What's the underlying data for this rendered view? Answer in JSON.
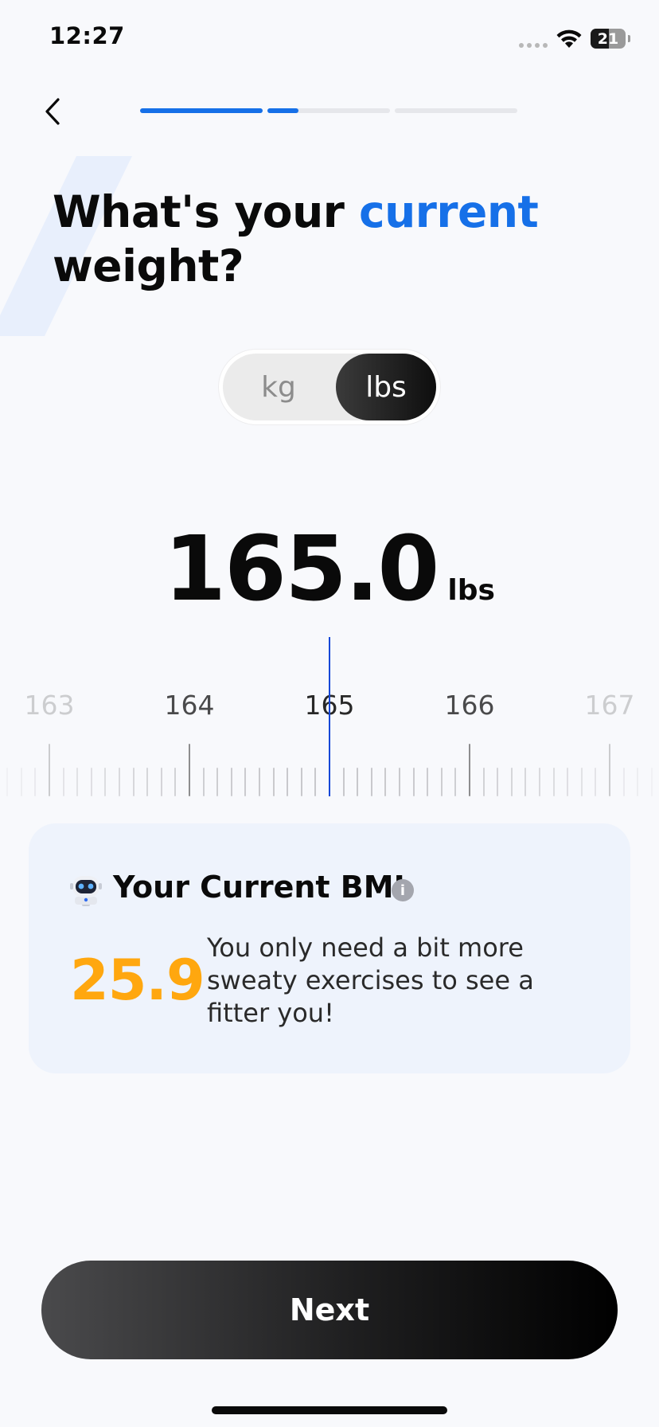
{
  "status_bar": {
    "time": "12:27",
    "battery_level": "21"
  },
  "header": {
    "back_icon": "chevron-left-icon",
    "progress": {
      "accent": "#1670E8",
      "steps_filled": [
        1.0,
        0.25,
        0.0,
        0.0
      ]
    }
  },
  "question": {
    "text_before": "What's your ",
    "accent_word": "current",
    "text_after": " weight?",
    "accent_color": "#1670E8"
  },
  "unit_toggle": {
    "options": [
      "kg",
      "lbs"
    ],
    "selected": "lbs"
  },
  "weight": {
    "value": "165.0",
    "unit": "lbs"
  },
  "ruler": {
    "labels": [
      "163",
      "164",
      "165",
      "166",
      "167"
    ],
    "selected_value": 165,
    "pointer_color": "#1448D8"
  },
  "bmi_card": {
    "icon": "robot-icon",
    "title": "Your Current BMI",
    "info_icon": "info-icon",
    "info_glyph": "i",
    "value": "25.9",
    "value_color": "#FFA70F",
    "message": "You only need a bit more sweaty exercises to see a fitter you!"
  },
  "next_button": {
    "label": "Next"
  }
}
